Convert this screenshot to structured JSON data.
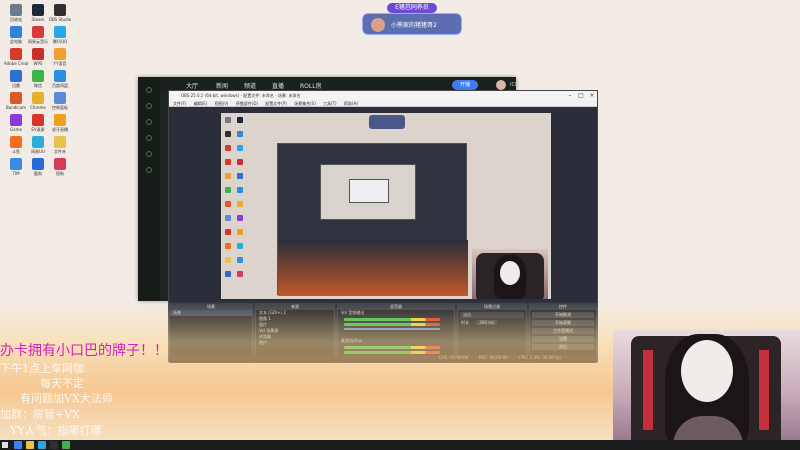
{
  "colors": {
    "desktop_bg": "#f3ece6",
    "obs_bg": "#2b2e38",
    "live_app_bg": "#1d2520",
    "accent_blue": "#3d7cf0",
    "badge_purple": "#6b4bd8",
    "marquee_magenta": "#d020c0"
  },
  "badge": {
    "title": "E猪芭同养员",
    "name": "小熊家的猪猪哥2"
  },
  "live_app": {
    "tabs": [
      "大厅",
      "新闻",
      "频道",
      "直播",
      "ROLL房"
    ],
    "button": "开播",
    "username": "ICF"
  },
  "obs": {
    "title": "OBS 25.0.1 (64-bit, windows) - 配置文件: 未命名 - 场景: 未命名",
    "menu": [
      "文件(F)",
      "编辑(E)",
      "视图(V)",
      "停靠部件(D)",
      "配置文件(P)",
      "场景集合(S)",
      "工具(T)",
      "帮助(H)"
    ],
    "docks": {
      "scenes_header": "场景",
      "scenes": [
        "场景"
      ],
      "sources_header": "来源",
      "sources": [
        "文本 (GDI+) 2",
        "图像 1",
        "图片",
        "Vol 场景源",
        "浏览器",
        "图片"
      ],
      "mixer_header": "混音器",
      "mixer_channels": [
        "Vol 音频输出",
        "麦克风/Aux"
      ],
      "transitions_header": "场景过渡",
      "transition_value": "淡出",
      "duration_label": "时长",
      "duration_value": "300 ms",
      "controls_header": "控件",
      "controls": [
        "开始推流",
        "开始录制",
        "工作室模式",
        "设置",
        "退出"
      ]
    },
    "status": {
      "live": "LIVE: 00:00:00",
      "rec": "REC: 00:00:00",
      "cpu": "CPU: 2.3%, 30.00 fps"
    }
  },
  "desktop_icons": [
    {
      "label": "回收站",
      "color": "#6d7b8c"
    },
    {
      "label": "Steam",
      "color": "#1b2838"
    },
    {
      "label": "OBS Studio",
      "color": "#302e31"
    },
    {
      "label": "此电脑",
      "color": "#2f86d8"
    },
    {
      "label": "网易云音乐",
      "color": "#d63a3a"
    },
    {
      "label": "腾讯QQ",
      "color": "#2aa7e8"
    },
    {
      "label": "Adobe Creati...",
      "color": "#d83b2a"
    },
    {
      "label": "WPS",
      "color": "#c9302c"
    },
    {
      "label": "YY语音",
      "color": "#f0a030"
    },
    {
      "label": "迅雷",
      "color": "#2a72d8"
    },
    {
      "label": "微信",
      "color": "#3bb44a"
    },
    {
      "label": "百度网盘",
      "color": "#2a8de8"
    },
    {
      "label": "Bandicam",
      "color": "#d85a2a"
    },
    {
      "label": "Chrome",
      "color": "#e8b02a"
    },
    {
      "label": "控制面板",
      "color": "#5a8ad8"
    },
    {
      "label": "Game",
      "color": "#8a3ad8"
    },
    {
      "label": "EV录屏",
      "color": "#d8342a"
    },
    {
      "label": "虎牙直播",
      "color": "#f0a020"
    },
    {
      "label": "斗鱼",
      "color": "#f07020"
    },
    {
      "label": "网易UU",
      "color": "#2ab0d8"
    },
    {
      "label": "文件夹",
      "color": "#e8c24a"
    },
    {
      "label": "TIM",
      "color": "#3a8ae8"
    },
    {
      "label": "酷狗",
      "color": "#2a6ad8"
    },
    {
      "label": "搜狗",
      "color": "#d83a5a"
    }
  ],
  "marquee": [
    "办卡拥有小口巴的牌子！！",
    "下午1点上车网咖",
    "每天不定",
    "有问题加VX大法师",
    "加群：房管+VX",
    "YY人气：指哪打哪"
  ]
}
